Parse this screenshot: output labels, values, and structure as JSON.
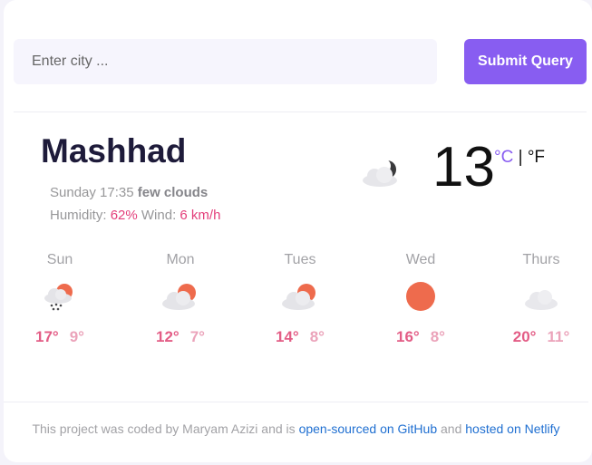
{
  "search": {
    "placeholder": "Enter city ...",
    "submit_label": "Submit Query"
  },
  "current": {
    "city": "Mashhad",
    "day_time": "Sunday 17:35",
    "description": "few clouds",
    "humidity_label": "Humidity:",
    "humidity_value": "62%",
    "wind_label": "Wind:",
    "wind_value": "6 km/h",
    "icon": "partly-cloudy-night-icon",
    "temperature": "13",
    "unit_c": "°C",
    "unit_sep": "|",
    "unit_f": "°F"
  },
  "forecast": [
    {
      "day": "Sun",
      "icon": "rain-cloud-sun-icon",
      "max": "17°",
      "min": "9°"
    },
    {
      "day": "Mon",
      "icon": "cloud-sun-icon",
      "max": "12°",
      "min": "7°"
    },
    {
      "day": "Tues",
      "icon": "cloud-sun-icon",
      "max": "14°",
      "min": "8°"
    },
    {
      "day": "Wed",
      "icon": "sun-icon",
      "max": "16°",
      "min": "8°"
    },
    {
      "day": "Thurs",
      "icon": "cloud-icon",
      "max": "20°",
      "min": "11°"
    }
  ],
  "footer": {
    "prefix": "This project was coded by Maryam Azizi and is",
    "github_link": "open-sourced on GitHub",
    "middle": "and",
    "netlify_link": "hosted on Netlify"
  },
  "colors": {
    "accent": "#885df1",
    "highlight": "#e33f7b",
    "sun": "#ee6b4d"
  }
}
